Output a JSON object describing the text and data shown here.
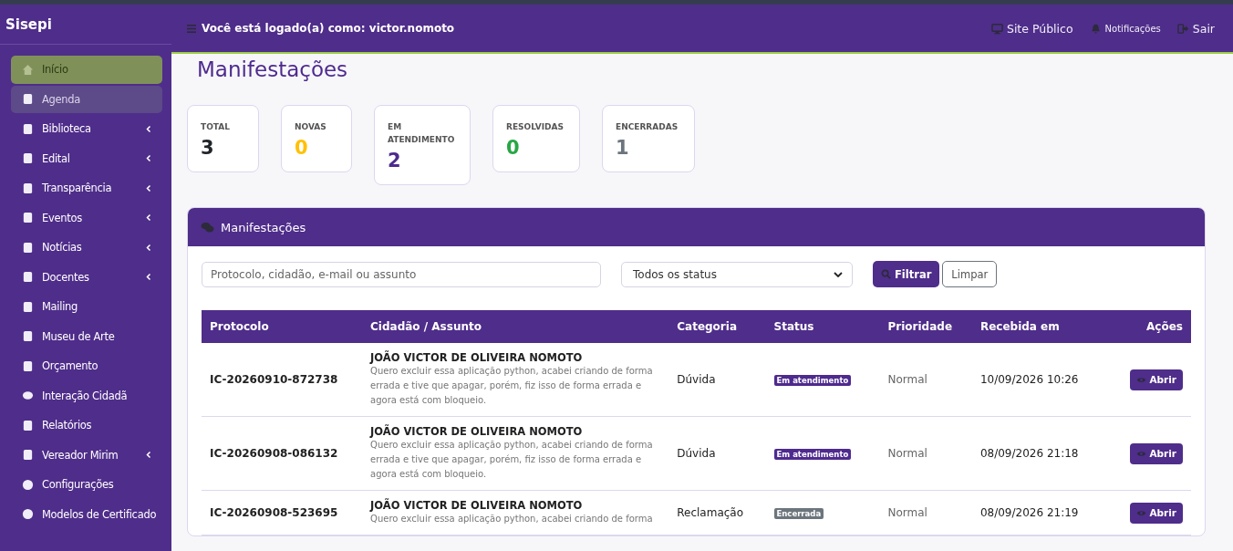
{
  "sidebar": {
    "brand": "Sisepi",
    "items": [
      {
        "label": "Início",
        "selected": true,
        "highlighted": false,
        "expandable": false
      },
      {
        "label": "Agenda",
        "selected": false,
        "highlighted": true,
        "expandable": false
      },
      {
        "label": "Biblioteca",
        "selected": false,
        "highlighted": false,
        "expandable": true
      },
      {
        "label": "Edital",
        "selected": false,
        "highlighted": false,
        "expandable": true
      },
      {
        "label": "Transparência",
        "selected": false,
        "highlighted": false,
        "expandable": true
      },
      {
        "label": "Eventos",
        "selected": false,
        "highlighted": false,
        "expandable": true
      },
      {
        "label": "Notícias",
        "selected": false,
        "highlighted": false,
        "expandable": true
      },
      {
        "label": "Docentes",
        "selected": false,
        "highlighted": false,
        "expandable": true
      },
      {
        "label": "Mailing",
        "selected": false,
        "highlighted": false,
        "expandable": false
      },
      {
        "label": "Museu de Arte",
        "selected": false,
        "highlighted": false,
        "expandable": false
      },
      {
        "label": "Orçamento",
        "selected": false,
        "highlighted": false,
        "expandable": false
      },
      {
        "label": "Interação Cidadã",
        "selected": false,
        "highlighted": false,
        "expandable": false
      },
      {
        "label": "Relatórios",
        "selected": false,
        "highlighted": false,
        "expandable": false
      },
      {
        "label": "Vereador Mirim",
        "selected": false,
        "highlighted": false,
        "expandable": true
      },
      {
        "label": "Configurações",
        "selected": false,
        "highlighted": false,
        "expandable": false
      },
      {
        "label": "Modelos de Certificado",
        "selected": false,
        "highlighted": false,
        "expandable": false
      }
    ]
  },
  "topbar": {
    "user_text": "Você está logado(a) como: victor.nomoto",
    "links": [
      "Site Público",
      "Notificações",
      "Sair"
    ]
  },
  "page_title": "Manifestações",
  "stats": [
    {
      "label": "TOTAL",
      "value": "3",
      "color": "#212529"
    },
    {
      "label": "NOVAS",
      "value": "0",
      "color": "#ffc107"
    },
    {
      "label": "EM ATENDIMENTO",
      "value": "2",
      "color": "#4e2a8e"
    },
    {
      "label": "RESOLVIDAS",
      "value": "0",
      "color": "#28a745"
    },
    {
      "label": "ENCERRADAS",
      "value": "1",
      "color": "#6c757d"
    }
  ],
  "panel": {
    "title": "Manifestações",
    "search": {
      "placeholder": "Protocolo, cidadão, e-mail ou assunto"
    },
    "status_select": "Todos os status",
    "buttons": [
      "Filtrar",
      "Limpar"
    ],
    "table": {
      "columns": [
        "Protocolo",
        "Cidadão / Assunto",
        "Categoria",
        "Status",
        "Prioridade",
        "Recebida em",
        "Ações"
      ],
      "rows": [
        {
          "protocol": "IC-20260910-872738",
          "citizen": "JOÃO VICTOR DE OLIVEIRA NOMOTO",
          "subject": "Quero excluir essa aplicação python, acabei criando de forma errada e tive que apagar, porém, fiz isso de forma errada e agora está com bloqueio.",
          "category": "Dúvida",
          "status": "Em atendimento",
          "color": "#4e2a8e",
          "priority": "Normal",
          "received": "10/09/2026 10:26",
          "action": "Abrir"
        },
        {
          "protocol": "IC-20260908-086132",
          "citizen": "JOÃO VICTOR DE OLIVEIRA NOMOTO",
          "subject": "Quero excluir essa aplicação python, acabei criando de forma errada e tive que apagar, porém, fiz isso de forma errada e agora está com bloqueio.",
          "category": "Dúvida",
          "status": "Em atendimento",
          "color": "#4e2a8e",
          "priority": "Normal",
          "received": "08/09/2026 21:18",
          "action": "Abrir"
        },
        {
          "protocol": "IC-20260908-523695",
          "citizen": "JOÃO VICTOR DE OLIVEIRA NOMOTO",
          "subject": "Quero excluir essa aplicação python, acabei criando de forma",
          "category": "Reclamação",
          "status": "Encerrada",
          "color": "#6c757d",
          "priority": "Normal",
          "received": "08/09/2026 21:19",
          "action": "Abrir"
        }
      ]
    }
  }
}
